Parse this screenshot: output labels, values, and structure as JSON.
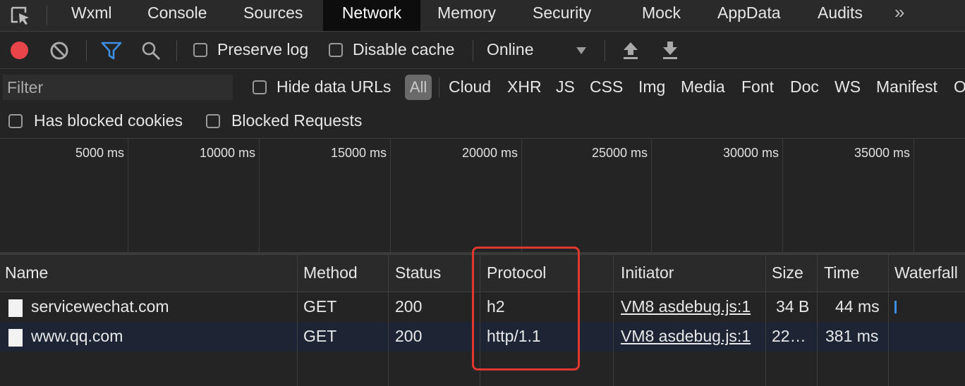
{
  "tabs": [
    "Wxml",
    "Console",
    "Sources",
    "Network",
    "Memory",
    "Security",
    "Mock",
    "AppData",
    "Audits"
  ],
  "more_glyph": "»",
  "toolbar": {
    "preserve_log": "Preserve log",
    "disable_cache": "Disable cache",
    "throttle": "Online",
    "icons": [
      "record-icon",
      "clear-icon",
      "filter-icon",
      "search-icon",
      "upload-icon",
      "download-icon"
    ],
    "record_color": "#e8454b",
    "filter_color": "#3d8fe6"
  },
  "filter": {
    "placeholder": "Filter",
    "hide_data_urls": "Hide data URLs",
    "all": "All",
    "types": [
      "Cloud",
      "XHR",
      "JS",
      "CSS",
      "Img",
      "Media",
      "Font",
      "Doc",
      "WS",
      "Manifest",
      "O"
    ],
    "has_blocked_cookies": "Has blocked cookies",
    "blocked_requests": "Blocked Requests"
  },
  "timeline": {
    "ticks": [
      "5000 ms",
      "10000 ms",
      "15000 ms",
      "20000 ms",
      "25000 ms",
      "30000 ms",
      "35000 ms"
    ]
  },
  "table": {
    "headers": [
      "Name",
      "Method",
      "Status",
      "Protocol",
      "Initiator",
      "Size",
      "Time",
      "Waterfall"
    ],
    "rows": [
      {
        "name": "servicewechat.com",
        "method": "GET",
        "status": "200",
        "protocol": "h2",
        "initiator": "VM8 asdebug.js:1",
        "size": "34 B",
        "time": "44 ms"
      },
      {
        "name": "www.qq.com",
        "method": "GET",
        "status": "200",
        "protocol": "http/1.1",
        "initiator": "VM8 asdebug.js:1",
        "size": "22…",
        "time": "381 ms"
      }
    ]
  },
  "colors": {
    "highlight": "#e0382e",
    "selected_row": "#1d2535"
  }
}
